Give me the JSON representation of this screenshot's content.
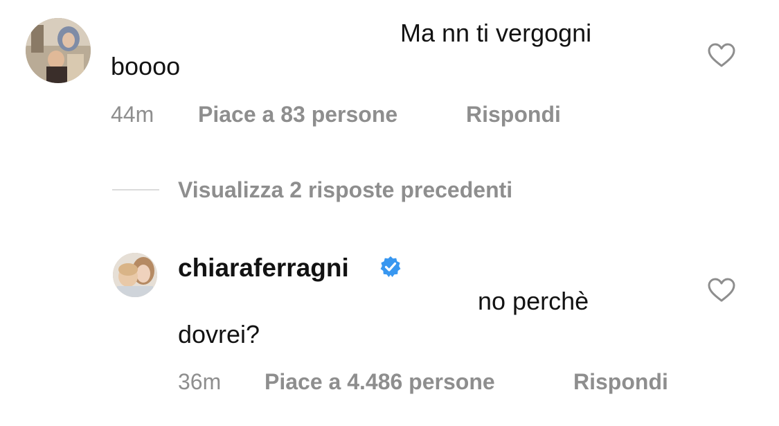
{
  "comment_1": {
    "avatar_icon": "user-avatar-photo",
    "text_line_1": "Ma nn ti vergogni",
    "text_line_2": "boooo",
    "time": "44m",
    "likes": "Piace a 83 persone",
    "reply": "Rispondi",
    "like_icon": "heart-outline-icon"
  },
  "replies_toggle": {
    "label": "Visualizza 2 risposte precedenti"
  },
  "comment_2": {
    "avatar_icon": "user-avatar-photo",
    "username": "chiaraferragni",
    "verified_icon": "verified-badge-icon",
    "text_line_1": "no perchè",
    "text_line_2": "dovrei?",
    "time": "36m",
    "likes": "Piace a 4.486 persone",
    "reply": "Rispondi",
    "like_icon": "heart-outline-icon"
  },
  "colors": {
    "text": "#121212",
    "secondary": "#8e8e8e",
    "divider": "#dbdbdb",
    "verified": "#3897f0"
  }
}
